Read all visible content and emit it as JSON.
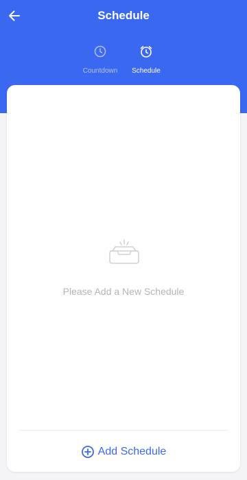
{
  "header": {
    "title": "Schedule",
    "back_icon": "arrow-left-icon",
    "background_color": "#3b68f0"
  },
  "tabs": [
    {
      "label": "Countdown",
      "icon": "clock-icon",
      "active": false
    },
    {
      "label": "Schedule",
      "icon": "alarm-clock-icon",
      "active": true
    }
  ],
  "main": {
    "empty_state": {
      "icon": "empty-inbox-icon",
      "message": "Please Add a New Schedule"
    },
    "add_button": {
      "label": "Add Schedule",
      "icon": "plus-circle-icon",
      "color": "#3b68f0"
    }
  }
}
